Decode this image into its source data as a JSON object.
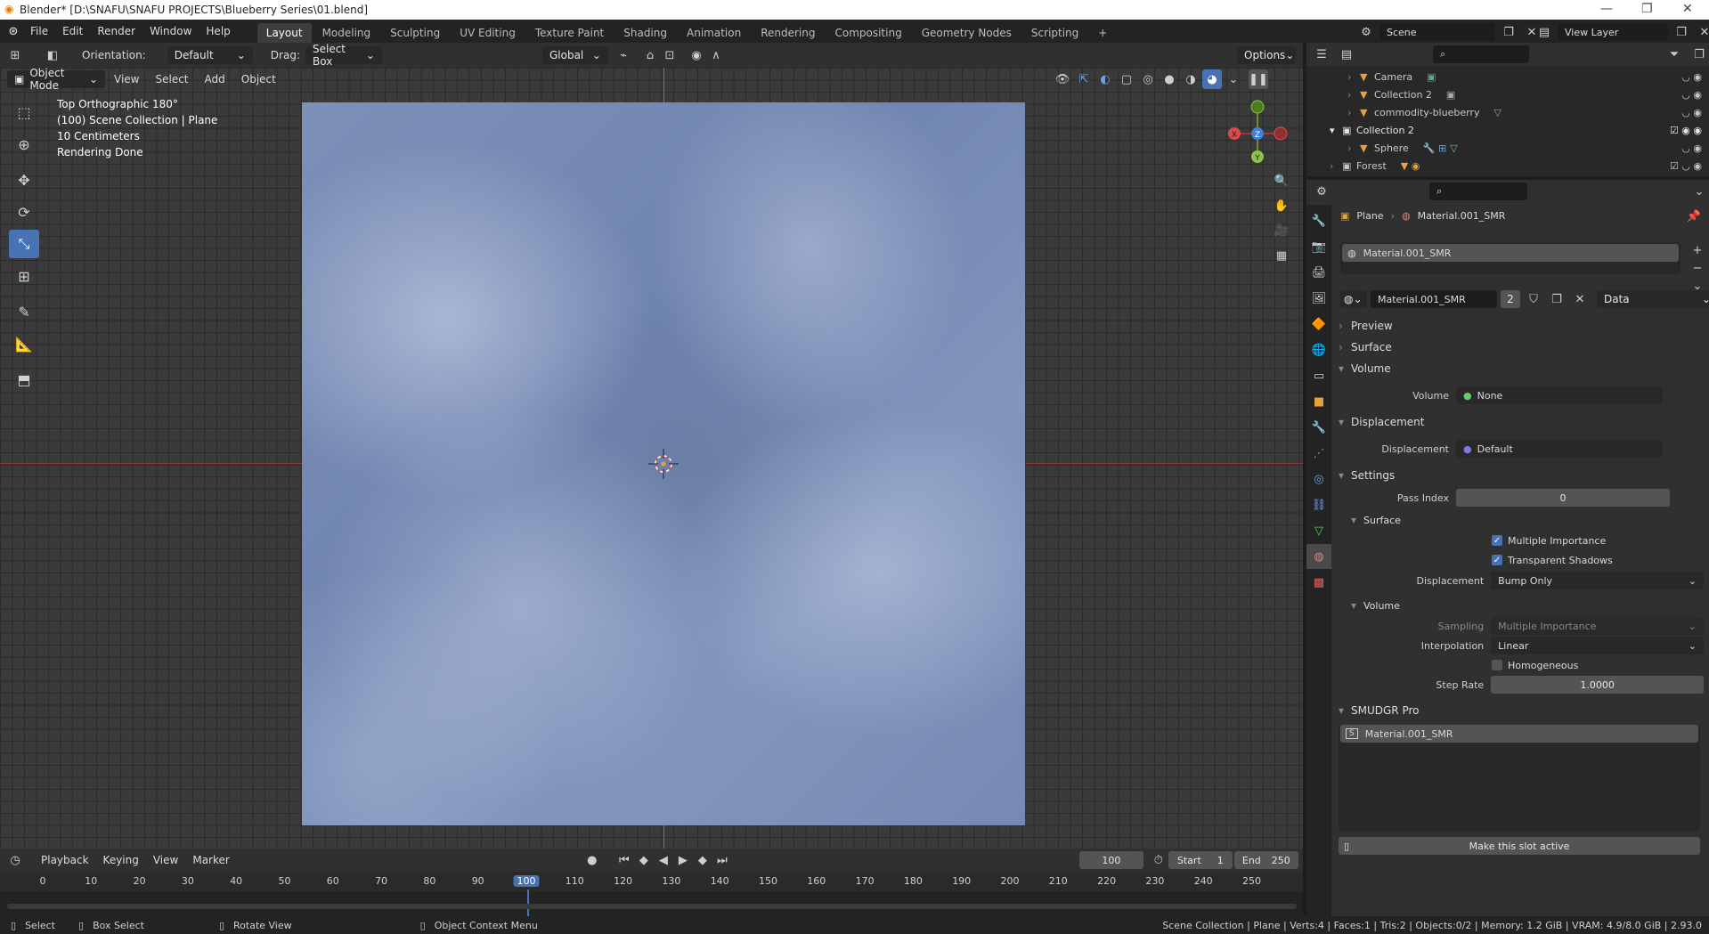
{
  "window": {
    "title": "Blender* [D:\\SNAFU\\SNAFU PROJECTS\\Blueberry Series\\01.blend]"
  },
  "menu": [
    "File",
    "Edit",
    "Render",
    "Window",
    "Help"
  ],
  "workspaces": [
    "Layout",
    "Modeling",
    "Sculpting",
    "UV Editing",
    "Texture Paint",
    "Shading",
    "Animation",
    "Rendering",
    "Compositing",
    "Geometry Nodes",
    "Scripting"
  ],
  "scene": {
    "name": "Scene",
    "view_layer": "View Layer"
  },
  "toolheader": {
    "orientation_label": "Orientation:",
    "orientation_value": "Default",
    "drag_label": "Drag:",
    "drag_value": "Select Box",
    "transform": "Global",
    "options": "Options"
  },
  "viewport_header": {
    "mode": "Object Mode",
    "menus": [
      "View",
      "Select",
      "Add",
      "Object"
    ]
  },
  "viewport_overlay": {
    "view_name": "Top Orthographic 180°",
    "collection": "(100) Scene Collection | Plane",
    "scale": "10 Centimeters",
    "status": "Rendering Done"
  },
  "gizmo": {
    "x": "X",
    "y": "Y",
    "z": "Z"
  },
  "outliner": {
    "rows": [
      {
        "name": "Camera",
        "indent": 2
      },
      {
        "name": "Collection 2",
        "indent": 2
      },
      {
        "name": "commodity-blueberry",
        "indent": 2
      },
      {
        "name": "Collection 2",
        "indent": 1
      },
      {
        "name": "Sphere",
        "indent": 2
      },
      {
        "name": "Forest",
        "indent": 1
      }
    ]
  },
  "properties": {
    "breadcrumb_object": "Plane",
    "breadcrumb_material": "Material.001_SMR",
    "slot_name": "Material.001_SMR",
    "material_name": "Material.001_SMR",
    "users": "2",
    "link": "Data",
    "panels": {
      "preview": "Preview",
      "surface": "Surface",
      "volume": "Volume",
      "volume_label": "Volume",
      "volume_value": "None",
      "displacement": "Displacement",
      "displacement_label": "Displacement",
      "displacement_value": "Default",
      "settings": "Settings",
      "pass_index_label": "Pass Index",
      "pass_index_value": "0",
      "surface_sub": "Surface",
      "multiple_importance": "Multiple Importance",
      "transparent_shadows": "Transparent Shadows",
      "disp_method_label": "Displacement",
      "disp_method_value": "Bump Only",
      "volume_sub": "Volume",
      "sampling_label": "Sampling",
      "sampling_value": "Multiple Importance",
      "interpolation_label": "Interpolation",
      "interpolation_value": "Linear",
      "homogeneous": "Homogeneous",
      "step_rate_label": "Step Rate",
      "step_rate_value": "1.0000",
      "smudgr": "SMUDGR Pro",
      "smudgr_item": "Material.001_SMR",
      "make_active": "Make this slot active"
    }
  },
  "timeline": {
    "menus": [
      "Playback",
      "Keying",
      "View",
      "Marker"
    ],
    "current_frame": "100",
    "start_label": "Start",
    "start": "1",
    "end_label": "End",
    "end": "250",
    "ticks": [
      "0",
      "10",
      "20",
      "30",
      "40",
      "50",
      "60",
      "70",
      "80",
      "90",
      "100",
      "110",
      "120",
      "130",
      "140",
      "150",
      "160",
      "170",
      "180",
      "190",
      "200",
      "210",
      "220",
      "230",
      "240",
      "250"
    ]
  },
  "statusbar": {
    "select": "Select",
    "box_select": "Box Select",
    "rotate": "Rotate View",
    "context": "Object Context Menu",
    "info": "Scene Collection | Plane | Verts:4 | Faces:1 | Tris:2 | Objects:0/2 | Memory: 1.2 GiB | VRAM: 4.9/8.0 GiB | 2.93.0"
  }
}
